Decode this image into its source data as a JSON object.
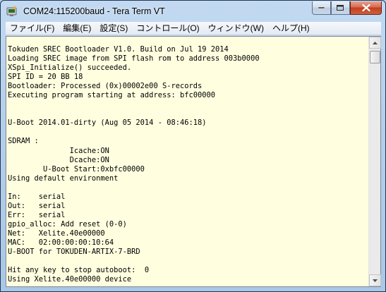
{
  "window": {
    "title": "COM24:115200baud - Tera Term VT"
  },
  "menu": {
    "items": [
      {
        "label": "ファイル(F)"
      },
      {
        "label": "編集(E)"
      },
      {
        "label": "設定(S)"
      },
      {
        "label": "コントロール(O)"
      },
      {
        "label": "ウィンドウ(W)"
      },
      {
        "label": "ヘルプ(H)"
      }
    ]
  },
  "terminal": {
    "lines": [
      "Tokuden SREC Bootloader V1.0. Build on Jul 19 2014",
      "Loading SREC image from SPI flash rom to address 003b0000",
      "XSpi_Initialize() succeeded.",
      "SPI ID = 20 BB 18",
      "Bootloader: Processed (0x)00002e00 S-records",
      "Executing program starting at address: bfc00000",
      "",
      "",
      "U-Boot 2014.01-dirty (Aug 05 2014 - 08:46:18)",
      "",
      "SDRAM :",
      "              Icache:ON",
      "              Dcache:ON",
      "        U-Boot Start:0xbfc00000",
      "Using default environment",
      "",
      "In:    serial",
      "Out:   serial",
      "Err:   serial",
      "gpio_alloc: Add reset (0-0)",
      "Net:   Xelite.40e00000",
      "MAC:   02:00:00:00:10:64",
      "U-BOOT for TOKUDEN-ARTIX-7-BRD",
      "",
      "Hit any key to stop autoboot:  0",
      "Using Xelite.40e00000 device"
    ]
  },
  "colors": {
    "terminal_bg": "#ffffe0",
    "terminal_fg": "#000000",
    "titlebar": "#b9d1ea",
    "close_button": "#c7432a"
  }
}
